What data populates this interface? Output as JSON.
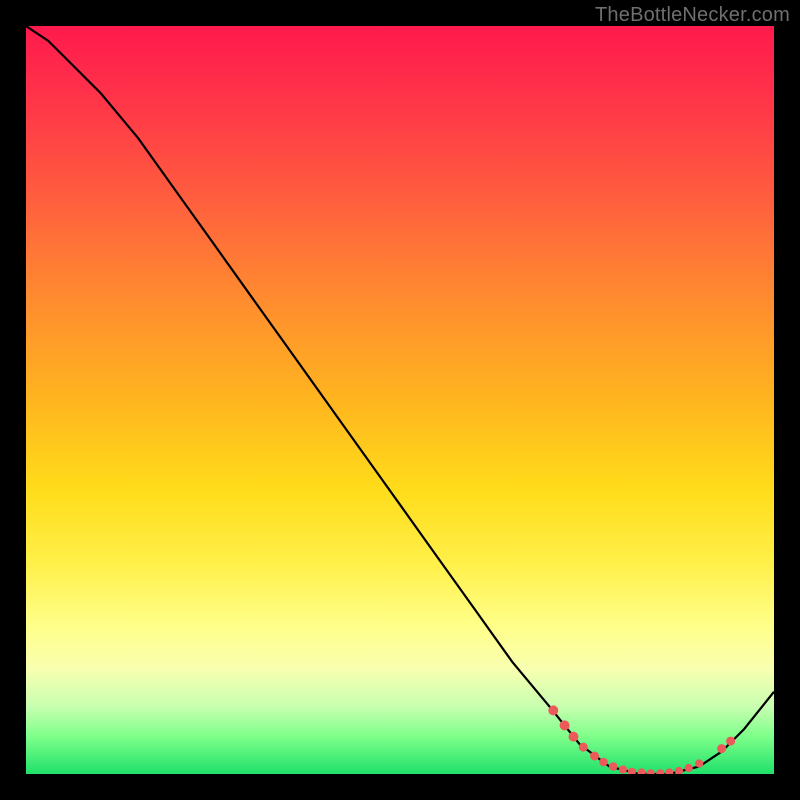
{
  "watermark": "TheBottleNecker.com",
  "chart_data": {
    "type": "line",
    "title": "",
    "xlabel": "",
    "ylabel": "",
    "xlim": [
      0,
      100
    ],
    "ylim": [
      0,
      100
    ],
    "series": [
      {
        "name": "bottleneck-curve",
        "x": [
          0,
          3,
          6,
          10,
          15,
          20,
          25,
          30,
          35,
          40,
          45,
          50,
          55,
          60,
          65,
          70,
          74,
          78,
          82,
          86,
          90,
          93,
          96,
          100
        ],
        "y": [
          100,
          98,
          95,
          91,
          85,
          78,
          71,
          64,
          57,
          50,
          43,
          36,
          29,
          22,
          15,
          9,
          4,
          1,
          0,
          0,
          1,
          3,
          6,
          11
        ]
      }
    ],
    "scatter": {
      "name": "highlight-points",
      "points": [
        {
          "x": 70.5,
          "y": 8.5,
          "r": 4.5
        },
        {
          "x": 72.0,
          "y": 6.5,
          "r": 4.5
        },
        {
          "x": 73.2,
          "y": 5.0,
          "r": 4.5
        },
        {
          "x": 74.5,
          "y": 3.6,
          "r": 4.0
        },
        {
          "x": 76.0,
          "y": 2.4,
          "r": 4.0
        },
        {
          "x": 77.2,
          "y": 1.6,
          "r": 3.8
        },
        {
          "x": 78.5,
          "y": 1.0,
          "r": 3.8
        },
        {
          "x": 79.8,
          "y": 0.6,
          "r": 3.6
        },
        {
          "x": 81.0,
          "y": 0.3,
          "r": 3.6
        },
        {
          "x": 82.3,
          "y": 0.2,
          "r": 3.6
        },
        {
          "x": 83.5,
          "y": 0.1,
          "r": 3.6
        },
        {
          "x": 84.8,
          "y": 0.1,
          "r": 3.6
        },
        {
          "x": 86.0,
          "y": 0.2,
          "r": 3.6
        },
        {
          "x": 87.3,
          "y": 0.4,
          "r": 3.6
        },
        {
          "x": 88.6,
          "y": 0.8,
          "r": 3.6
        },
        {
          "x": 90.0,
          "y": 1.4,
          "r": 3.6
        },
        {
          "x": 93.0,
          "y": 3.4,
          "r": 4.0
        },
        {
          "x": 94.2,
          "y": 4.4,
          "r": 4.0
        }
      ]
    }
  }
}
